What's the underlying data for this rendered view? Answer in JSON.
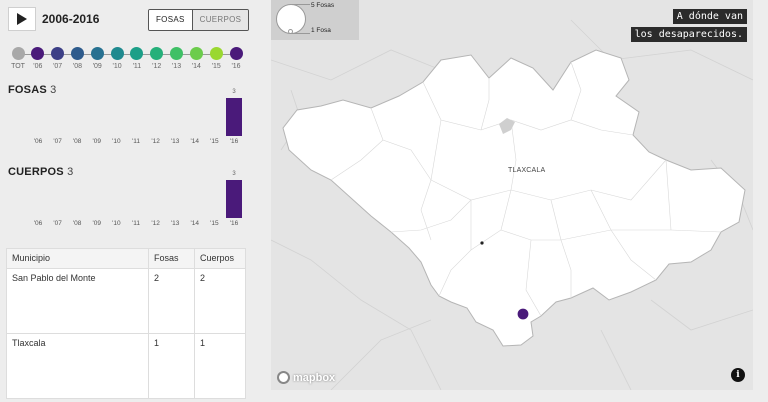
{
  "controls": {
    "range": "2006-2016",
    "toggle_active": "FOSAS",
    "toggle_inactive": "CUERPOS"
  },
  "timeline": [
    {
      "label": "TOT",
      "color": "#a8a8a8"
    },
    {
      "label": "'06",
      "color": "#4a1a7a"
    },
    {
      "label": "'07",
      "color": "#3c3f86"
    },
    {
      "label": "'08",
      "color": "#2e5b8c"
    },
    {
      "label": "'09",
      "color": "#277191"
    },
    {
      "label": "'10",
      "color": "#1f8a8f"
    },
    {
      "label": "'11",
      "color": "#1c9f88"
    },
    {
      "label": "'12",
      "color": "#25b07a"
    },
    {
      "label": "'13",
      "color": "#3fc066"
    },
    {
      "label": "'14",
      "color": "#6ccc4c"
    },
    {
      "label": "'15",
      "color": "#9ad830"
    },
    {
      "label": "'16",
      "color": "#4a1a7a"
    }
  ],
  "fosas": {
    "title": "FOSAS",
    "count": "3"
  },
  "cuerpos": {
    "title": "CUERPOS",
    "count": "3"
  },
  "chart_data": [
    {
      "type": "bar",
      "categories": [
        "'06",
        "'07",
        "'08",
        "'09",
        "'10",
        "'11",
        "'12",
        "'13",
        "'14",
        "'15",
        "'16"
      ],
      "values": [
        0,
        0,
        0,
        0,
        0,
        0,
        0,
        0,
        0,
        0,
        3
      ],
      "data_labels": [
        "",
        "",
        "",
        "",
        "",
        "",
        "",
        "",
        "",
        "",
        "3"
      ],
      "title": "FOSAS",
      "color": "#4a1a7a"
    },
    {
      "type": "bar",
      "categories": [
        "'06",
        "'07",
        "'08",
        "'09",
        "'10",
        "'11",
        "'12",
        "'13",
        "'14",
        "'15",
        "'16"
      ],
      "values": [
        0,
        0,
        0,
        0,
        0,
        0,
        0,
        0,
        0,
        0,
        3
      ],
      "data_labels": [
        "",
        "",
        "",
        "",
        "",
        "",
        "",
        "",
        "",
        "",
        "3"
      ],
      "title": "CUERPOS",
      "color": "#4a1a7a"
    }
  ],
  "table": {
    "headers": [
      "Municipio",
      "Fosas",
      "Cuerpos"
    ],
    "rows": [
      [
        "San Pablo del Monte",
        "2",
        "2"
      ],
      [
        "Tlaxcala",
        "1",
        "1"
      ]
    ]
  },
  "map": {
    "legend_big": "5 Fosas",
    "legend_small": "1 Fosa",
    "banner_line1": "A dónde van",
    "banner_line2": "los desaparecidos.",
    "state_label": "TLAXCALA",
    "attribution": "mapbox",
    "info": "i",
    "marker_color": "#4a1a7a"
  }
}
